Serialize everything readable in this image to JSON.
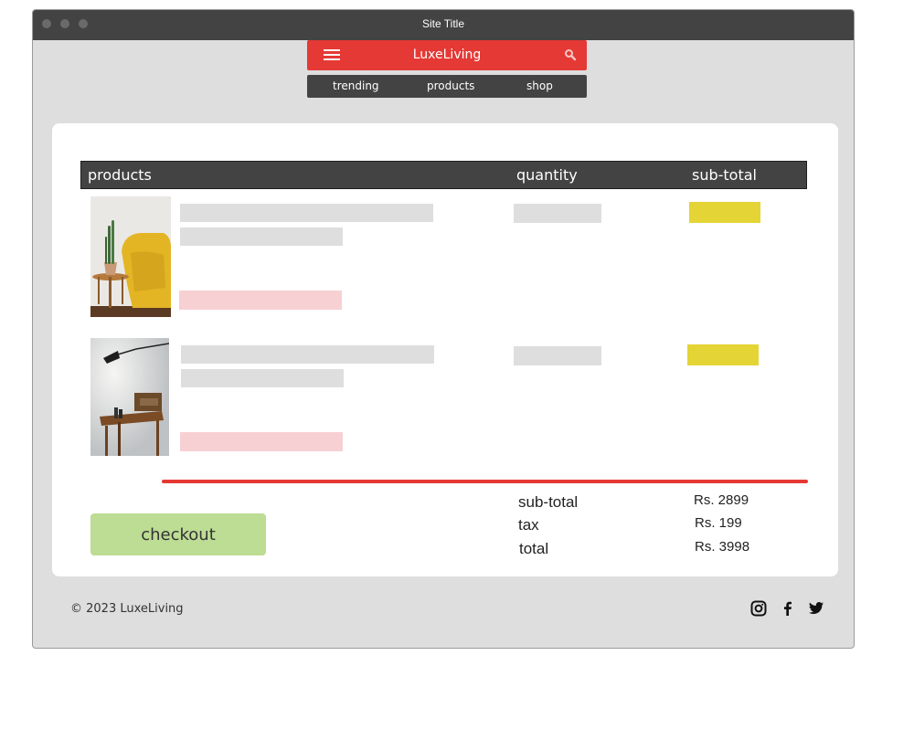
{
  "window": {
    "title": "Site Title"
  },
  "header": {
    "brand": "LuxeLiving",
    "accent_color": "#e53935"
  },
  "nav": {
    "items": [
      "trending",
      "products",
      "shop"
    ]
  },
  "cart": {
    "columns": [
      "products",
      "quantity",
      "sub-total"
    ],
    "items": [
      {
        "image": "yellow-armchair-with-cactus-photo"
      },
      {
        "image": "wall-lamp-with-wooden-table-photo"
      }
    ]
  },
  "checkout": {
    "label": "checkout"
  },
  "summary": {
    "subtotal_label": "sub-total",
    "subtotal_value": "Rs. 2899",
    "tax_label": "tax",
    "tax_value": "Rs. 199",
    "total_label": "total",
    "total_value": "Rs. 3998"
  },
  "footer": {
    "copyright": "© 2023 LuxeLiving",
    "social": [
      "instagram-icon",
      "facebook-icon",
      "twitter-icon"
    ]
  }
}
